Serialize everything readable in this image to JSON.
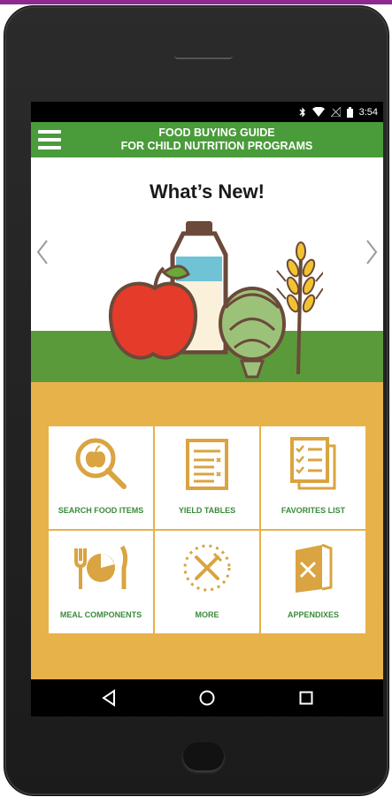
{
  "status_bar": {
    "time": "3:54",
    "icons": [
      "bluetooth-icon",
      "wifi-icon",
      "signal-icon",
      "battery-icon"
    ]
  },
  "app_bar": {
    "title_line1": "FOOD BUYING GUIDE",
    "title_line2": "FOR CHILD NUTRITION PROGRAMS",
    "menu_icon": "hamburger-menu-icon"
  },
  "banner": {
    "title": "What’s New!"
  },
  "tiles": [
    {
      "label": "SEARCH FOOD ITEMS",
      "icon": "search-food-icon"
    },
    {
      "label": "YIELD TABLES",
      "icon": "yield-table-icon"
    },
    {
      "label": "FAVORITES LIST",
      "icon": "favorites-list-icon"
    },
    {
      "label": "MEAL COMPONENTS",
      "icon": "meal-components-icon"
    },
    {
      "label": "MORE",
      "icon": "more-icon"
    },
    {
      "label": "APPENDIXES",
      "icon": "appendixes-icon"
    }
  ],
  "nav_bar": [
    "back-icon",
    "home-icon",
    "recents-icon"
  ],
  "colors": {
    "app_bar": "#4a9b3a",
    "accent_gold": "#e8b24a",
    "icon_gold": "#d9a441",
    "label_green": "#3a8a3a"
  }
}
